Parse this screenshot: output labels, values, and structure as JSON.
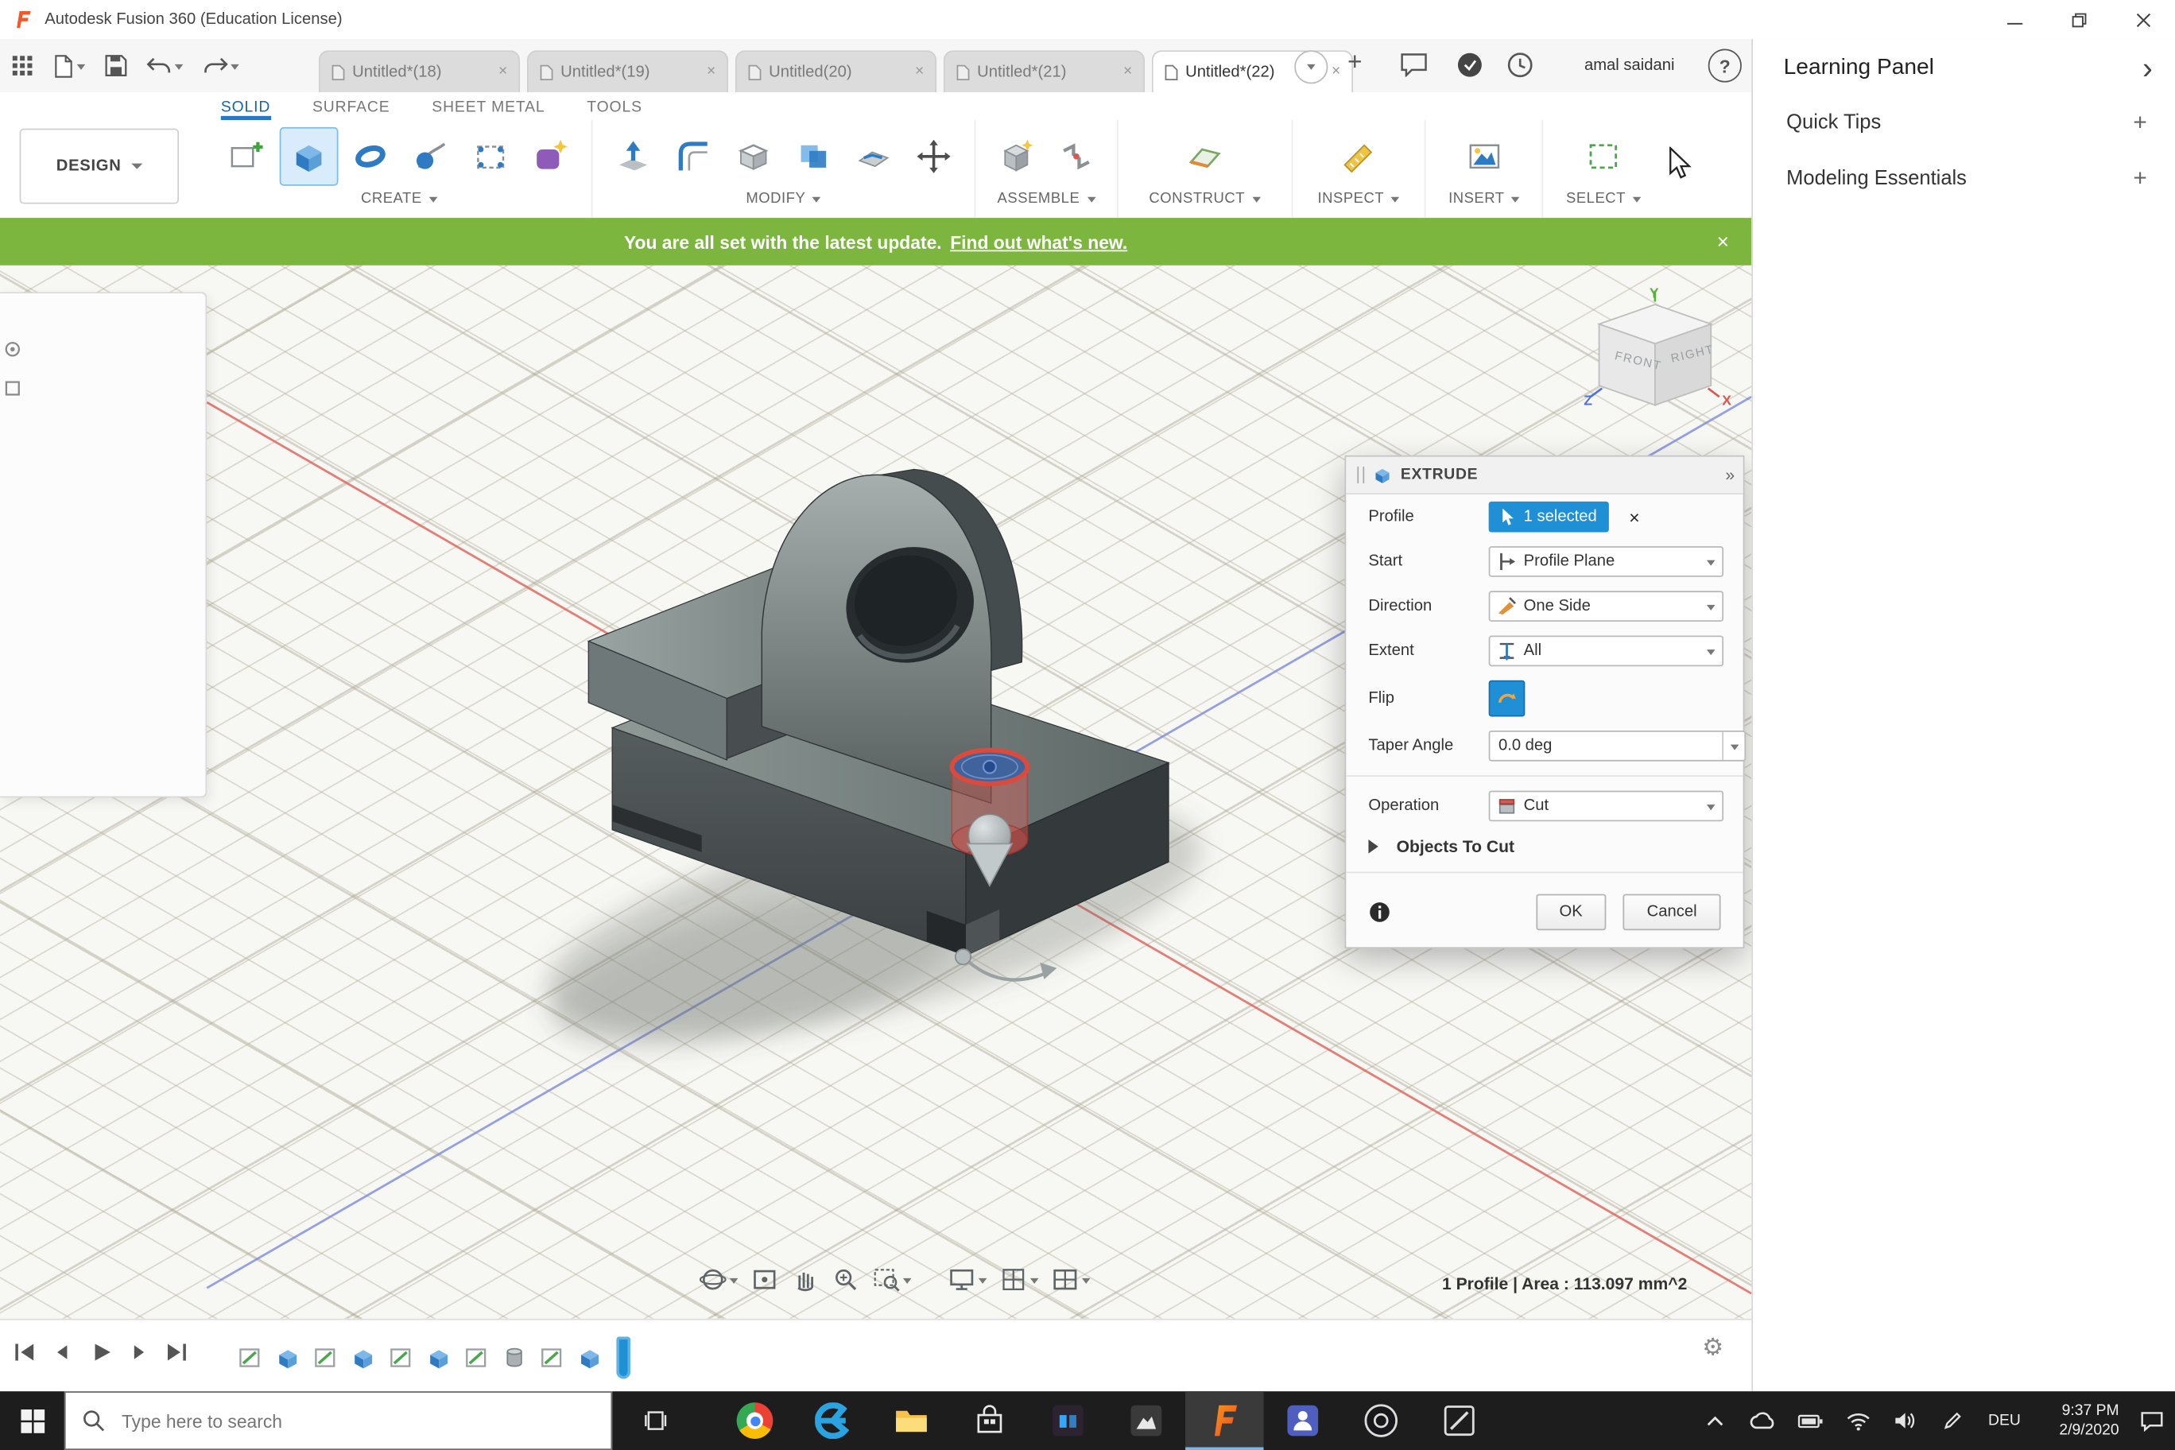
{
  "icons": {
    "close": "×",
    "plus": "+",
    "chevron_right": "›",
    "help": "?",
    "flyout": "»",
    "gear": "⚙"
  },
  "titlebar": {
    "title": "Autodesk Fusion 360 (Education License)"
  },
  "docbar": {
    "tabs": [
      {
        "label": "Untitled*(18)"
      },
      {
        "label": "Untitled*(19)"
      },
      {
        "label": "Untitled(20)"
      },
      {
        "label": "Untitled*(21)"
      },
      {
        "label": "Untitled*(22)"
      }
    ],
    "user": "amal saidani"
  },
  "ribbon": {
    "workspace": "DESIGN",
    "tabs": [
      "SOLID",
      "SURFACE",
      "SHEET METAL",
      "TOOLS"
    ],
    "groups": [
      "CREATE",
      "MODIFY",
      "ASSEMBLE",
      "CONSTRUCT",
      "INSPECT",
      "INSERT",
      "SELECT"
    ]
  },
  "banner": {
    "text": "You are all set with the latest update.",
    "link": "Find out what's new."
  },
  "learning": {
    "title": "Learning Panel",
    "items": [
      "Quick Tips",
      "Modeling Essentials"
    ]
  },
  "viewcube": {
    "front": "FRONT",
    "right": "RIGHT",
    "x": "X",
    "y": "Y",
    "z": "Z"
  },
  "extrude": {
    "title": "EXTRUDE",
    "profile_label": "Profile",
    "profile_value": "1 selected",
    "start_label": "Start",
    "start_value": "Profile Plane",
    "direction_label": "Direction",
    "direction_value": "One Side",
    "extent_label": "Extent",
    "extent_value": "All",
    "flip_label": "Flip",
    "taper_label": "Taper Angle",
    "taper_value": "0.0 deg",
    "operation_label": "Operation",
    "operation_value": "Cut",
    "objects_to_cut": "Objects To Cut",
    "ok": "OK",
    "cancel": "Cancel"
  },
  "status": {
    "selection": "1 Profile | Area : 113.097 mm^2"
  },
  "taskbar": {
    "search_placeholder": "Type here to search",
    "lang": "DEU",
    "time": "9:37 PM",
    "date": "2/9/2020"
  }
}
